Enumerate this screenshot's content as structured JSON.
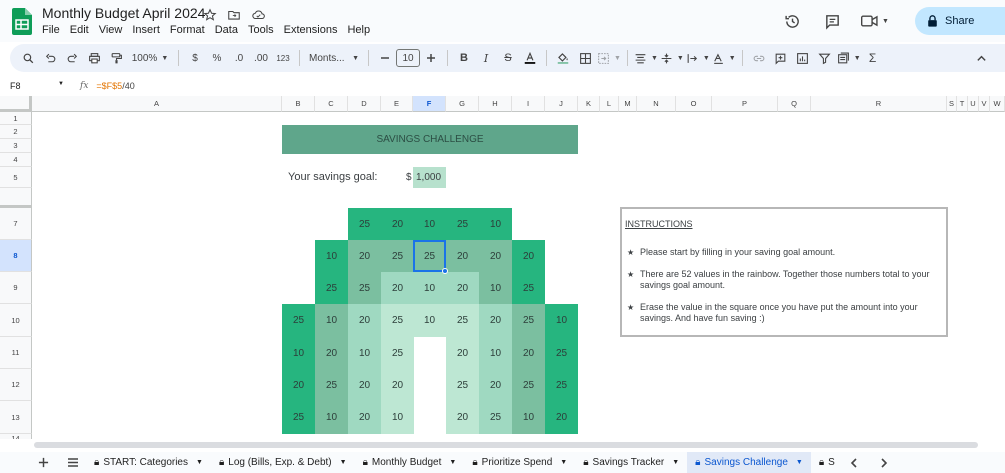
{
  "title_bar": {
    "doc_title": "Monthly Budget April 2024",
    "menu": [
      "File",
      "Edit",
      "View",
      "Insert",
      "Format",
      "Data",
      "Tools",
      "Extensions",
      "Help"
    ],
    "share_label": "Share"
  },
  "toolbar": {
    "zoom": "100%",
    "currency": "$",
    "percent": "%",
    "dec_decrease": ".0",
    "dec_increase": ".00",
    "number_format": "123",
    "font": "Monts...",
    "font_size": "10"
  },
  "formula_bar": {
    "cell_ref": "F8",
    "fx": "fx",
    "formula_ref": "=$F$5",
    "formula_rest": "/40"
  },
  "columns": [
    "A",
    "B",
    "C",
    "D",
    "E",
    "F",
    "G",
    "H",
    "I",
    "J",
    "K",
    "L",
    "M",
    "N",
    "O",
    "P",
    "Q",
    "R",
    "S",
    "T",
    "U",
    "V",
    "W"
  ],
  "rows": [
    "1",
    "2",
    "3",
    "4",
    "5",
    "7",
    "8",
    "9",
    "10",
    "11",
    "12",
    "13",
    "14"
  ],
  "savings": {
    "banner": "SAVINGS CHALLENGE",
    "goal_label": "Your savings goal:",
    "goal_currency": "$",
    "goal_value": "1,000"
  },
  "rainbow": {
    "r7": [
      "25",
      "20",
      "10",
      "25",
      "10"
    ],
    "r8": [
      "10",
      "20",
      "25",
      "25",
      "20",
      "20",
      "20"
    ],
    "r9": [
      "25",
      "25",
      "20",
      "10",
      "20",
      "10",
      "25"
    ],
    "r10": [
      "25",
      "10",
      "20",
      "25",
      "10",
      "25",
      "20",
      "25",
      "10"
    ],
    "r11": [
      "10",
      "20",
      "10",
      "25",
      "20",
      "10",
      "20",
      "25"
    ],
    "r12": [
      "20",
      "25",
      "20",
      "20",
      "25",
      "20",
      "25",
      "25"
    ],
    "r13": [
      "25",
      "10",
      "20",
      "10",
      "20",
      "25",
      "10",
      "20"
    ]
  },
  "instructions": {
    "title": "INSTRUCTIONS",
    "items": [
      "Please start by filling in your saving goal amount.",
      "There are 52 values in the rainbow. Together those numbers total to your savings goal amount.",
      "Erase the value in the square once you have put the amount into your savings. And have fun saving :)"
    ]
  },
  "sheet_tabs": {
    "tabs": [
      "START: Categories",
      "Log (Bills, Exp. & Debt)",
      "Monthly Budget",
      "Prioritize Spend",
      "Savings Tracker",
      "Savings Challenge",
      "S"
    ],
    "active_tab": "Savings Challenge"
  },
  "colors": {
    "accent": "#0b57d0",
    "green_dark": "#26b57f",
    "green_mid": "#7bbfa0",
    "green_light": "#9fd9c1",
    "green_pale": "#bde7d3",
    "banner": "#5fa68b"
  }
}
